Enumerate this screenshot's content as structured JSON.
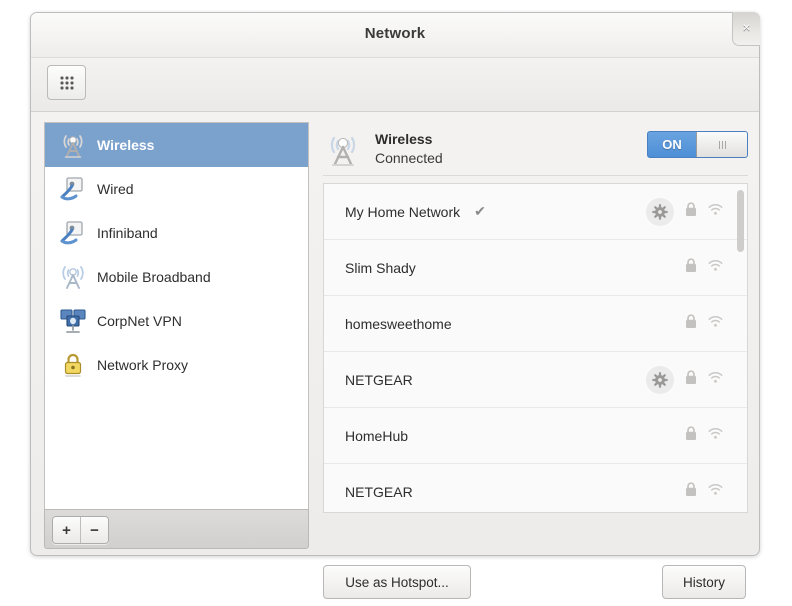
{
  "window": {
    "title": "Network",
    "close_label": "×"
  },
  "toolbar": {
    "grid_button_name": "all-settings-grid-button"
  },
  "sidebar": {
    "items": [
      {
        "label": "Wireless",
        "icon": "wireless-tower-icon",
        "selected": true
      },
      {
        "label": "Wired",
        "icon": "wired-plug-icon",
        "selected": false
      },
      {
        "label": "Infiniband",
        "icon": "infiniband-plug-icon",
        "selected": false
      },
      {
        "label": "Mobile Broadband",
        "icon": "mobile-broadband-icon",
        "selected": false
      },
      {
        "label": "CorpNet VPN",
        "icon": "vpn-computer-icon",
        "selected": false
      },
      {
        "label": "Network Proxy",
        "icon": "proxy-padlock-icon",
        "selected": false
      }
    ],
    "add_label": "+",
    "remove_label": "−"
  },
  "device": {
    "name": "Wireless",
    "status": "Connected",
    "toggle_label": "ON",
    "toggle_state": "on"
  },
  "networks": [
    {
      "name": "My Home Network",
      "connected": true,
      "check": "✔",
      "has_settings": true,
      "secured": true,
      "signal": 3
    },
    {
      "name": "Slim Shady",
      "connected": false,
      "check": "",
      "has_settings": false,
      "secured": true,
      "signal": 2
    },
    {
      "name": "homesweethome",
      "connected": false,
      "check": "",
      "has_settings": false,
      "secured": true,
      "signal": 2
    },
    {
      "name": "NETGEAR",
      "connected": false,
      "check": "",
      "has_settings": true,
      "secured": true,
      "signal": 2
    },
    {
      "name": "HomeHub",
      "connected": false,
      "check": "",
      "has_settings": false,
      "secured": true,
      "signal": 2
    },
    {
      "name": "NETGEAR",
      "connected": false,
      "check": "",
      "has_settings": false,
      "secured": true,
      "signal": 2
    }
  ],
  "footer": {
    "hotspot_label": "Use as Hotspot...",
    "history_label": "History"
  },
  "colors": {
    "selection_blue": "#7ba1cd",
    "toggle_blue": "#4e8fd6",
    "window_bg": "#f0eeec",
    "list_bg": "#fafafa"
  }
}
